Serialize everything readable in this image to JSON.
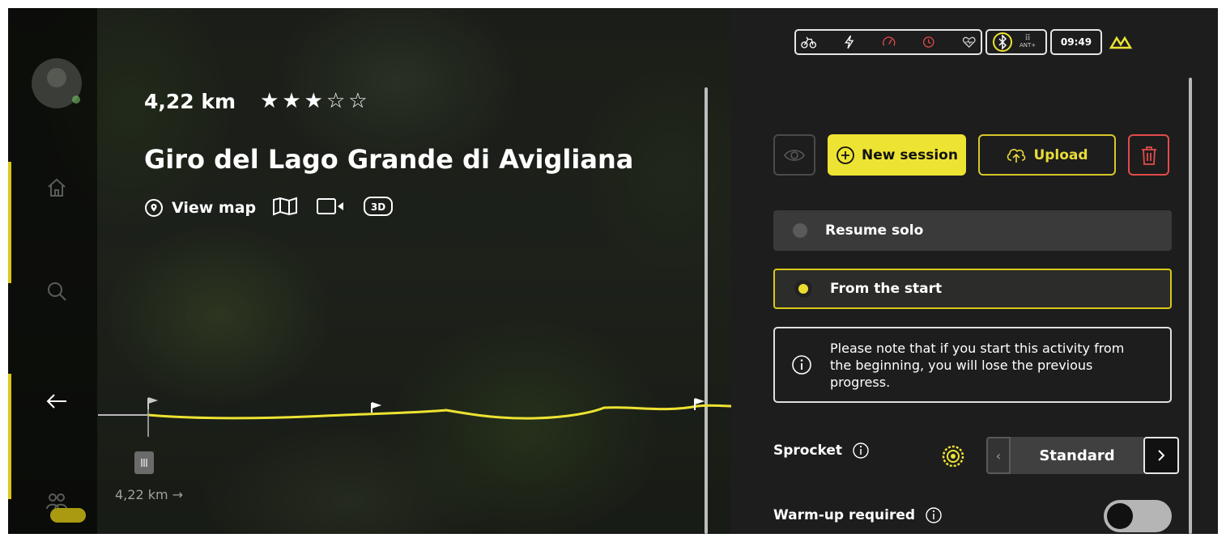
{
  "route": {
    "distance": "4,22 km",
    "rating": 3,
    "stars": "★★★☆☆",
    "title": "Giro del Lago Grande di Avigliana",
    "view_map_label": "View map",
    "position_label": "4,22 km →"
  },
  "status": {
    "time": "09:49",
    "ant_label": "ANT+"
  },
  "actions": {
    "new_session_label": "New session",
    "upload_label": "Upload"
  },
  "options": {
    "resume_label": "Resume solo",
    "from_start_label": "From the start",
    "selected": "From the start"
  },
  "note": {
    "text": "Please note that if you start this activity from the beginning, you will lose the previous progress."
  },
  "settings": {
    "sprocket_label": "Sprocket",
    "sprocket_value": "Standard",
    "warmup_label": "Warm-up required",
    "warmup_enabled": false
  },
  "colors": {
    "accent": "#ede332",
    "danger": "#e44b4b",
    "panel": "#1d1d1d"
  }
}
